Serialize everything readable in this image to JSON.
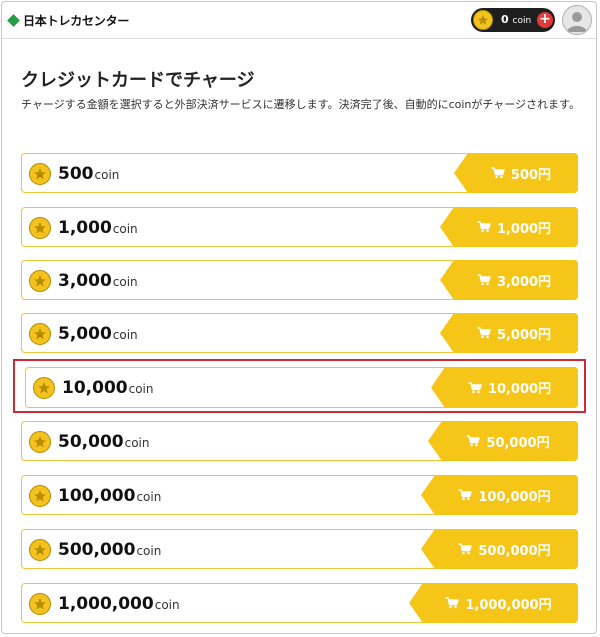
{
  "header": {
    "logo_text": "日本トレカセンター",
    "coin_balance": "0",
    "coin_unit": "coin",
    "add_label": "+"
  },
  "main": {
    "title": "クレジットカードでチャージ",
    "description": "チャージする金額を選択すると外部決済サービスに遷移します。決済完了後、自動的にcoinがチャージされます。"
  },
  "colors": {
    "accent": "#f5c518",
    "highlight": "#d02a35",
    "logo": "#22a046"
  },
  "icons": {
    "coin": "star-coin-icon",
    "cart": "cart-icon",
    "avatar": "user-avatar-icon"
  },
  "packages": [
    {
      "amount": "500",
      "unit": "coin",
      "price": "500円"
    },
    {
      "amount": "1,000",
      "unit": "coin",
      "price": "1,000円"
    },
    {
      "amount": "3,000",
      "unit": "coin",
      "price": "3,000円"
    },
    {
      "amount": "5,000",
      "unit": "coin",
      "price": "5,000円"
    },
    {
      "amount": "10,000",
      "unit": "coin",
      "price": "10,000円",
      "highlighted": true
    },
    {
      "amount": "50,000",
      "unit": "coin",
      "price": "50,000円"
    },
    {
      "amount": "100,000",
      "unit": "coin",
      "price": "100,000円"
    },
    {
      "amount": "500,000",
      "unit": "coin",
      "price": "500,000円"
    },
    {
      "amount": "1,000,000",
      "unit": "coin",
      "price": "1,000,000円"
    }
  ]
}
